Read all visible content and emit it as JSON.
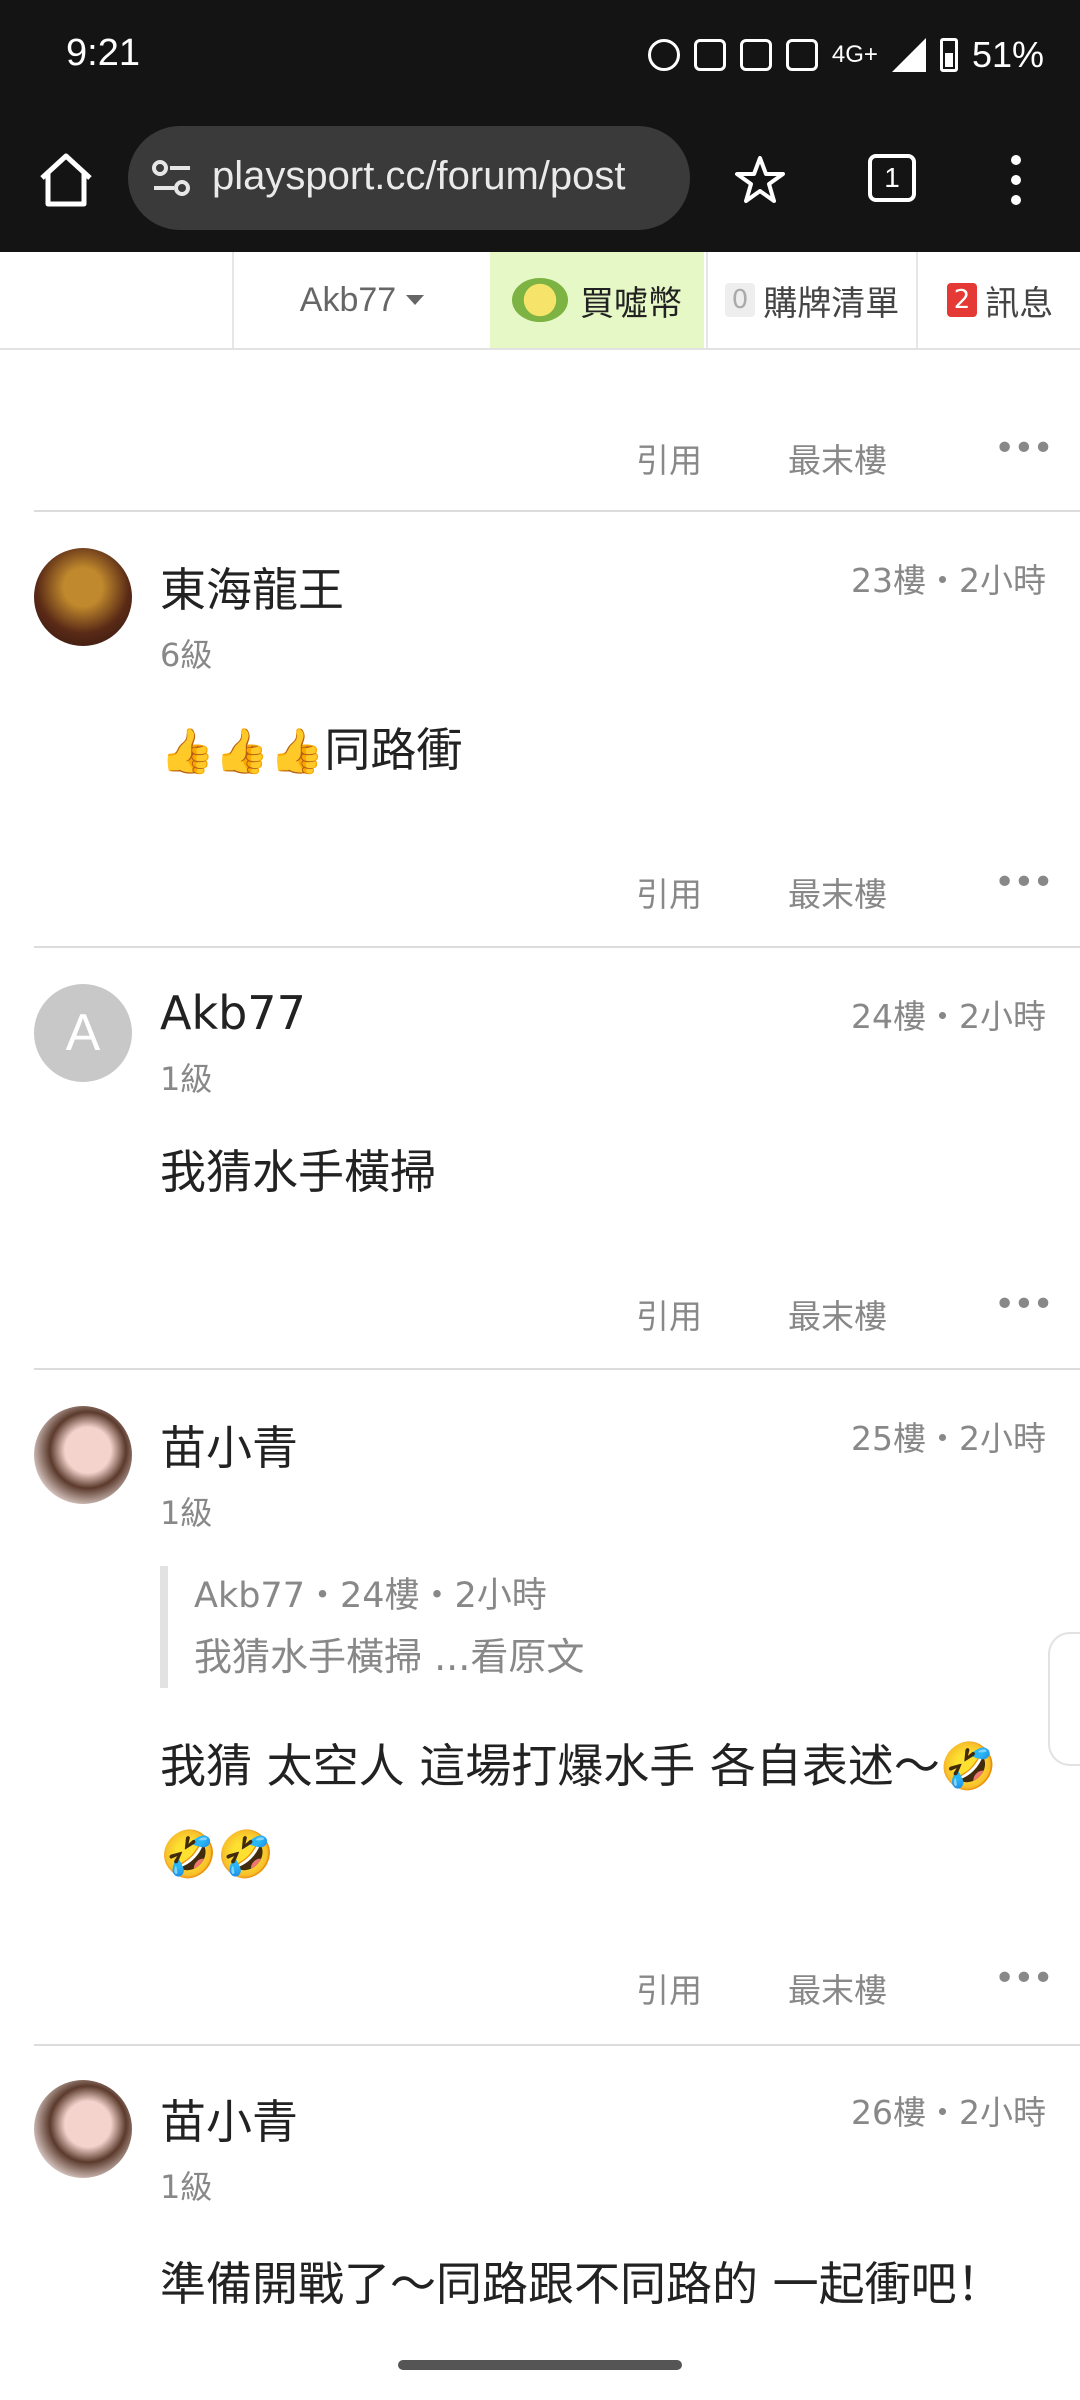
{
  "status_bar": {
    "time": "9:21",
    "network": "4G+",
    "hz": "120",
    "battery": "51%"
  },
  "browser": {
    "url": "playsport.cc/forum/post",
    "tab_count": "1"
  },
  "site_nav": {
    "user": "Akb77",
    "coin_label": "買噓幣",
    "cart_count": "0",
    "cart_label": "購牌清單",
    "msg_count": "2",
    "msg_label": "訊息"
  },
  "actions": {
    "quote": "引用",
    "last_floor": "最末樓",
    "more": "•••"
  },
  "posts": [
    {
      "author": "東海龍王",
      "meta": "23樓・2小時",
      "level": "6級",
      "body_text": "同路衝",
      "emoji": "👍👍👍"
    },
    {
      "author": "Akb77",
      "avatar_letter": "A",
      "meta": "24樓・2小時",
      "level": "1級",
      "body_text": "我猜水手橫掃"
    },
    {
      "author": "苗小青",
      "meta": "25樓・2小時",
      "level": "1級",
      "quote_head": "Akb77・24樓・2小時",
      "quote_body": "我猜水手橫掃 ...看原文",
      "body_line1": "我猜 太空人 這場打爆水手 各自表述～🤣",
      "body_line2": "🤣🤣"
    },
    {
      "author": "苗小青",
      "meta": "26樓・2小時",
      "level": "1級",
      "body_text": "準備開戰了～同路跟不同路的 一起衝吧！"
    }
  ]
}
